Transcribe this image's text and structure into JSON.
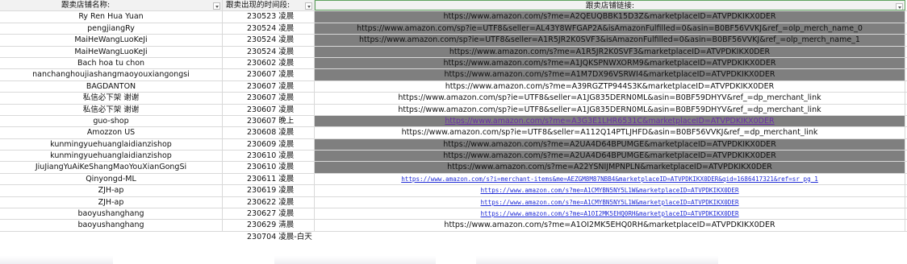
{
  "header": {
    "col1": "跟卖店铺名称:",
    "col2": "跟卖出现的时间段:",
    "col3": "跟卖店铺链接:"
  },
  "rows": [
    {
      "name": "Ry Ren Hua Yuan",
      "time": "230523 凌晨",
      "link": "https://www.amazon.com/s?me=A2QEUQBBK15D3Z&marketplaceID=ATVPDKIKX0DER"
    },
    {
      "name": "pengjiangRy",
      "time": "230524 凌晨",
      "link": "https://www.amazon.com/sp?ie=UTF8&seller=AL43Y8WFGAP2A&isAmazonFulfilled=0&asin=B0BF56VVKJ&ref_=olp_merch_name_0"
    },
    {
      "name": "MaiHeWangLuoKeJi",
      "time": "230524 凌晨",
      "link": "https://www.amazon.com/sp?ie=UTF8&seller=A1R5JR2K0SVF3&isAmazonFulfilled=0&asin=B0BF56VVKJ&ref_=olp_merch_name_1"
    },
    {
      "name": "MaiHeWangLuoKeJi",
      "time": "230524 凌晨",
      "link": "https://www.amazon.com/s?me=A1R5JR2K0SVF3&marketplaceID=ATVPDKIKX0DER"
    },
    {
      "name": "Bach hoa tu chon",
      "time": "230602 凌晨",
      "link": "https://www.amazon.com/s?me=A1JQKSPNWXORM9&marketplaceID=ATVPDKIKX0DER"
    },
    {
      "name": "nanchanghoujiashangmaoyouxiangongsi",
      "time": "230607 凌晨",
      "link": "https://www.amazon.com/s?me=A1M7DX96VSRWI4&marketplaceID=ATVPDKIKX0DER"
    },
    {
      "name": "BAGDANTON",
      "time": "230607 凌晨",
      "link": "https://www.amazon.com/s?me=A39RGZTP944S3K&marketplaceID=ATVPDKIKX0DER"
    },
    {
      "name": "私信必下架 谢谢",
      "time": "230607 凌晨",
      "link": "https://www.amazon.com/sp?ie=UTF8&seller=A1JG835DERN0ML&asin=B0BF59DHYV&ref_=dp_merchant_link"
    },
    {
      "name": "私信必下架 谢谢",
      "time": "230607 凌晨",
      "link": "https://www.amazon.com/sp?ie=UTF8&seller=A1JG835DERN0ML&asin=B0BF59DHYV&ref_=dp_merchant_link"
    },
    {
      "name": "guo-shop",
      "time": "230607 晚上",
      "link": "https://www.amazon.com/s?me=A3G3E1LHR6531C&marketplaceID=ATVPDKIKX0DER"
    },
    {
      "name": "Amozzon US",
      "time": "230608 凌晨",
      "link": "https://www.amazon.com/sp?ie=UTF8&seller=A112Q14PTLJHFD&asin=B0BF56VVKJ&ref_=dp_merchant_link"
    },
    {
      "name": "kunmingyuehuanglaidianzishop",
      "time": "230609 凌晨",
      "link": "https://www.amazon.com/s?me=A2UA4D64BPUMGE&marketplaceID=ATVPDKIKX0DER"
    },
    {
      "name": "kunmingyuehuanglaidianzishop",
      "time": "230610 凌晨",
      "link": "https://www.amazon.com/s?me=A2UA4D64BPUMGE&marketplaceID=ATVPDKIKX0DER"
    },
    {
      "name": "JiuJiangYuAiKeShangMaoYouXianGongSi",
      "time": "230610 凌晨",
      "link": "https://www.amazon.com/s?me=A22YSNIJMPNPLN&marketplaceID=ATVPDKIKX0DER"
    },
    {
      "name": "Qinyongd-ML",
      "time": "230611 凌晨",
      "link": "https://www.amazon.com/s?i=merchant-items&me=AEZGM8M87NBB4&marketplaceID=ATVPDKIKX0DER&qid=1686417321&ref=sr_pg_1"
    },
    {
      "name": "ZJH-ap",
      "time": "230619 凌晨",
      "link": "https://www.amazon.com/s?me=A1CMYBN5NY5L1W&marketplaceID=ATVPDKIKX0DER"
    },
    {
      "name": "ZJH-ap",
      "time": "230622 凌晨",
      "link": "https://www.amazon.com/s?me=A1CMYBN5NY5L1W&marketplaceID=ATVPDKIKX0DER"
    },
    {
      "name": "baoyushanghang",
      "time": "230627 凌晨",
      "link": "https://www.amazon.com/s?me=A1OI2MK5EHQ0RH&marketplaceID=ATVPDKIKX0DER"
    },
    {
      "name": "baoyushanghang",
      "time": "230629 清晨",
      "link": "https://www.amazon.com/s?me=A1OI2MK5EHQ0RH&marketplaceID=ATVPDKIKX0DER"
    },
    {
      "name": "",
      "time": "230704 凌晨-白天",
      "link": ""
    }
  ],
  "colors": {
    "gray_fill": "#7f7f7f",
    "link_blue": "#1f2bd6",
    "link_purple": "#6b2fa8",
    "selected_border": "#5fa35f"
  },
  "icons": [
    "filter-dropdown-icon"
  ]
}
